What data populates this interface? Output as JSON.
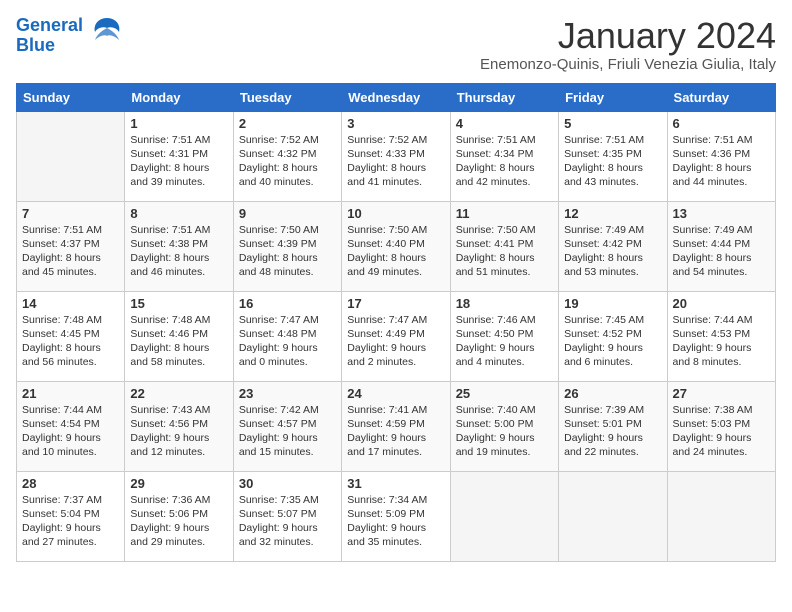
{
  "header": {
    "logo_line1": "General",
    "logo_line2": "Blue",
    "month": "January 2024",
    "location": "Enemonzo-Quinis, Friuli Venezia Giulia, Italy"
  },
  "days_of_week": [
    "Sunday",
    "Monday",
    "Tuesday",
    "Wednesday",
    "Thursday",
    "Friday",
    "Saturday"
  ],
  "weeks": [
    [
      {
        "day": "",
        "sunrise": "",
        "sunset": "",
        "daylight": "",
        "empty": true
      },
      {
        "day": "1",
        "sunrise": "Sunrise: 7:51 AM",
        "sunset": "Sunset: 4:31 PM",
        "daylight": "Daylight: 8 hours and 39 minutes."
      },
      {
        "day": "2",
        "sunrise": "Sunrise: 7:52 AM",
        "sunset": "Sunset: 4:32 PM",
        "daylight": "Daylight: 8 hours and 40 minutes."
      },
      {
        "day": "3",
        "sunrise": "Sunrise: 7:52 AM",
        "sunset": "Sunset: 4:33 PM",
        "daylight": "Daylight: 8 hours and 41 minutes."
      },
      {
        "day": "4",
        "sunrise": "Sunrise: 7:51 AM",
        "sunset": "Sunset: 4:34 PM",
        "daylight": "Daylight: 8 hours and 42 minutes."
      },
      {
        "day": "5",
        "sunrise": "Sunrise: 7:51 AM",
        "sunset": "Sunset: 4:35 PM",
        "daylight": "Daylight: 8 hours and 43 minutes."
      },
      {
        "day": "6",
        "sunrise": "Sunrise: 7:51 AM",
        "sunset": "Sunset: 4:36 PM",
        "daylight": "Daylight: 8 hours and 44 minutes."
      }
    ],
    [
      {
        "day": "7",
        "sunrise": "Sunrise: 7:51 AM",
        "sunset": "Sunset: 4:37 PM",
        "daylight": "Daylight: 8 hours and 45 minutes."
      },
      {
        "day": "8",
        "sunrise": "Sunrise: 7:51 AM",
        "sunset": "Sunset: 4:38 PM",
        "daylight": "Daylight: 8 hours and 46 minutes."
      },
      {
        "day": "9",
        "sunrise": "Sunrise: 7:50 AM",
        "sunset": "Sunset: 4:39 PM",
        "daylight": "Daylight: 8 hours and 48 minutes."
      },
      {
        "day": "10",
        "sunrise": "Sunrise: 7:50 AM",
        "sunset": "Sunset: 4:40 PM",
        "daylight": "Daylight: 8 hours and 49 minutes."
      },
      {
        "day": "11",
        "sunrise": "Sunrise: 7:50 AM",
        "sunset": "Sunset: 4:41 PM",
        "daylight": "Daylight: 8 hours and 51 minutes."
      },
      {
        "day": "12",
        "sunrise": "Sunrise: 7:49 AM",
        "sunset": "Sunset: 4:42 PM",
        "daylight": "Daylight: 8 hours and 53 minutes."
      },
      {
        "day": "13",
        "sunrise": "Sunrise: 7:49 AM",
        "sunset": "Sunset: 4:44 PM",
        "daylight": "Daylight: 8 hours and 54 minutes."
      }
    ],
    [
      {
        "day": "14",
        "sunrise": "Sunrise: 7:48 AM",
        "sunset": "Sunset: 4:45 PM",
        "daylight": "Daylight: 8 hours and 56 minutes."
      },
      {
        "day": "15",
        "sunrise": "Sunrise: 7:48 AM",
        "sunset": "Sunset: 4:46 PM",
        "daylight": "Daylight: 8 hours and 58 minutes."
      },
      {
        "day": "16",
        "sunrise": "Sunrise: 7:47 AM",
        "sunset": "Sunset: 4:48 PM",
        "daylight": "Daylight: 9 hours and 0 minutes."
      },
      {
        "day": "17",
        "sunrise": "Sunrise: 7:47 AM",
        "sunset": "Sunset: 4:49 PM",
        "daylight": "Daylight: 9 hours and 2 minutes."
      },
      {
        "day": "18",
        "sunrise": "Sunrise: 7:46 AM",
        "sunset": "Sunset: 4:50 PM",
        "daylight": "Daylight: 9 hours and 4 minutes."
      },
      {
        "day": "19",
        "sunrise": "Sunrise: 7:45 AM",
        "sunset": "Sunset: 4:52 PM",
        "daylight": "Daylight: 9 hours and 6 minutes."
      },
      {
        "day": "20",
        "sunrise": "Sunrise: 7:44 AM",
        "sunset": "Sunset: 4:53 PM",
        "daylight": "Daylight: 9 hours and 8 minutes."
      }
    ],
    [
      {
        "day": "21",
        "sunrise": "Sunrise: 7:44 AM",
        "sunset": "Sunset: 4:54 PM",
        "daylight": "Daylight: 9 hours and 10 minutes."
      },
      {
        "day": "22",
        "sunrise": "Sunrise: 7:43 AM",
        "sunset": "Sunset: 4:56 PM",
        "daylight": "Daylight: 9 hours and 12 minutes."
      },
      {
        "day": "23",
        "sunrise": "Sunrise: 7:42 AM",
        "sunset": "Sunset: 4:57 PM",
        "daylight": "Daylight: 9 hours and 15 minutes."
      },
      {
        "day": "24",
        "sunrise": "Sunrise: 7:41 AM",
        "sunset": "Sunset: 4:59 PM",
        "daylight": "Daylight: 9 hours and 17 minutes."
      },
      {
        "day": "25",
        "sunrise": "Sunrise: 7:40 AM",
        "sunset": "Sunset: 5:00 PM",
        "daylight": "Daylight: 9 hours and 19 minutes."
      },
      {
        "day": "26",
        "sunrise": "Sunrise: 7:39 AM",
        "sunset": "Sunset: 5:01 PM",
        "daylight": "Daylight: 9 hours and 22 minutes."
      },
      {
        "day": "27",
        "sunrise": "Sunrise: 7:38 AM",
        "sunset": "Sunset: 5:03 PM",
        "daylight": "Daylight: 9 hours and 24 minutes."
      }
    ],
    [
      {
        "day": "28",
        "sunrise": "Sunrise: 7:37 AM",
        "sunset": "Sunset: 5:04 PM",
        "daylight": "Daylight: 9 hours and 27 minutes."
      },
      {
        "day": "29",
        "sunrise": "Sunrise: 7:36 AM",
        "sunset": "Sunset: 5:06 PM",
        "daylight": "Daylight: 9 hours and 29 minutes."
      },
      {
        "day": "30",
        "sunrise": "Sunrise: 7:35 AM",
        "sunset": "Sunset: 5:07 PM",
        "daylight": "Daylight: 9 hours and 32 minutes."
      },
      {
        "day": "31",
        "sunrise": "Sunrise: 7:34 AM",
        "sunset": "Sunset: 5:09 PM",
        "daylight": "Daylight: 9 hours and 35 minutes."
      },
      {
        "day": "",
        "sunrise": "",
        "sunset": "",
        "daylight": "",
        "empty": true
      },
      {
        "day": "",
        "sunrise": "",
        "sunset": "",
        "daylight": "",
        "empty": true
      },
      {
        "day": "",
        "sunrise": "",
        "sunset": "",
        "daylight": "",
        "empty": true
      }
    ]
  ]
}
